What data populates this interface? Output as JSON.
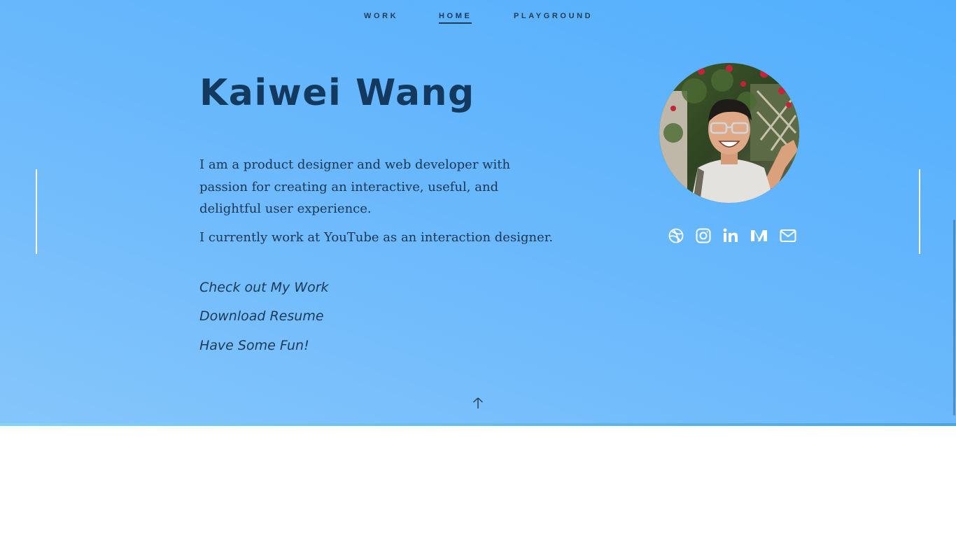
{
  "nav": {
    "items": [
      {
        "label": "WORK"
      },
      {
        "label": "HOME"
      },
      {
        "label": "PLAYGROUND"
      }
    ],
    "active_index": 1
  },
  "hero": {
    "name": "Kaiwei Wang",
    "bio_paragraph_1": "I am a product designer and web developer with passion for creating an interactive, useful, and delightful user experience.",
    "bio_paragraph_2": "I currently work at YouTube as an interaction designer.",
    "links": [
      {
        "label": "Check out My Work"
      },
      {
        "label": "Download Resume"
      },
      {
        "label": "Have Some Fun!"
      }
    ]
  },
  "socials": [
    {
      "icon": "dribbble-icon"
    },
    {
      "icon": "instagram-icon"
    },
    {
      "icon": "linkedin-icon"
    },
    {
      "icon": "medium-icon"
    },
    {
      "icon": "mail-icon"
    }
  ],
  "colors": {
    "hero_gradient_start": "#85c6fb",
    "hero_gradient_end": "#52affd",
    "text_dark": "#133a5e",
    "accent_line": "#46a6df"
  }
}
